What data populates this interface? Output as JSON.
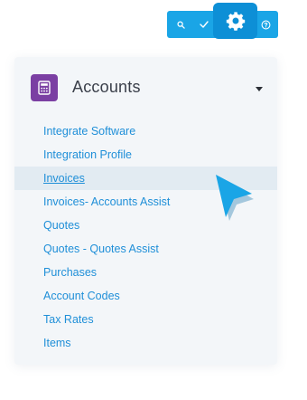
{
  "toolbar": {
    "icons": [
      "search-icon",
      "check-icon",
      "gear-icon",
      "help-icon"
    ],
    "accent": "#1aa5e6",
    "gear_bg": "#0d8fd6"
  },
  "panel": {
    "title": "Accounts",
    "icon": "calculator-icon",
    "icon_color": "#7b3fa3",
    "expanded": true
  },
  "menu": {
    "link_color": "#1f8fd8",
    "items": [
      {
        "label": "Integrate Software"
      },
      {
        "label": "Integration Profile"
      },
      {
        "label": "Invoices",
        "active": true
      },
      {
        "label": "Invoices- Accounts Assist"
      },
      {
        "label": "Quotes"
      },
      {
        "label": "Quotes - Quotes Assist"
      },
      {
        "label": "Purchases"
      },
      {
        "label": "Account Codes"
      },
      {
        "label": "Tax Rates"
      },
      {
        "label": "Items"
      }
    ]
  },
  "cursor": {
    "icon": "pointer-arrow-icon",
    "color": "#1aa5e6"
  }
}
